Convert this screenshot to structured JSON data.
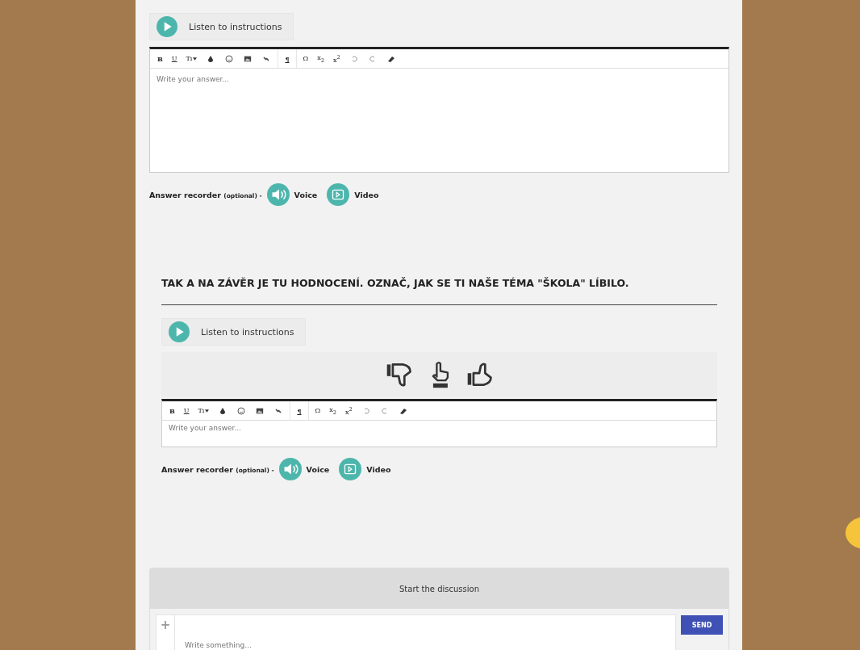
{
  "sections": [
    {
      "listen_label": "Listen to instructions",
      "toolbar": [
        "B",
        "U",
        "Tı",
        "¶",
        "Ω",
        "x$_{2}$",
        "x$^{2}$"
      ],
      "answer_placeholder": "Write your answer...",
      "tall": true,
      "rating": false,
      "recorder": {
        "label": "Answer recorder",
        "note": "(optional) -",
        "voice": "Voice",
        "video": "Video"
      }
    },
    {
      "heading": "TAK A NA ZÁVĚR JE TU HODNOCENÍ. OZNAČ, JAK SE TI NAŠE TÉMA \"ŠKOLA\" LÍBILO.",
      "listen_label": "Listen to instructions",
      "toolbar": [
        "B",
        "U",
        "Tı",
        "¶",
        "Ω",
        "x$_{2}$",
        "x$^{2}$"
      ],
      "answer_placeholder": "Write your answer...",
      "tall": false,
      "rating": true,
      "recorder": {
        "label": "Answer recorder",
        "note": "(optional) -",
        "voice": "Voice",
        "video": "Video"
      }
    }
  ],
  "discussion": {
    "title": "Start the discussion",
    "placeholder": "Write something...",
    "plus": "+",
    "send": "SEND"
  }
}
